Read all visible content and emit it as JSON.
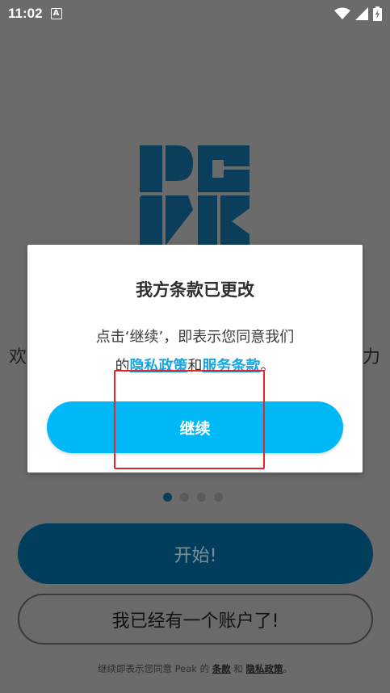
{
  "status_bar": {
    "time": "11:02",
    "notification_icon": "A",
    "icons": [
      "wifi-icon",
      "signal-icon",
      "battery-charging-icon"
    ]
  },
  "background": {
    "side_text_left": "欢",
    "side_text_right": "力",
    "pager": {
      "count": 4,
      "active_index": 0
    },
    "start_button_label": "开始!",
    "login_button_label": "我已经有一个账户了!",
    "terms": {
      "prefix": "继续即表示您同意 Peak 的 ",
      "terms_link": "条款",
      "middle": " 和 ",
      "privacy_link": "隐私政策",
      "suffix": "。"
    }
  },
  "dialog": {
    "title": "我方条款已更改",
    "line1": "点击‘继续’，即表示您同意我们",
    "line2_prefix": "的",
    "privacy_link": "隐私政策",
    "line2_middle": "和",
    "terms_link": "服务条款",
    "line2_suffix": "。",
    "continue_label": "继续"
  },
  "colors": {
    "overlay_bg": "#6b6b6b",
    "accent": "#00b8f5",
    "link": "#16a6e3",
    "brand_dark": "#003e5c",
    "highlight": "#e8232b"
  }
}
